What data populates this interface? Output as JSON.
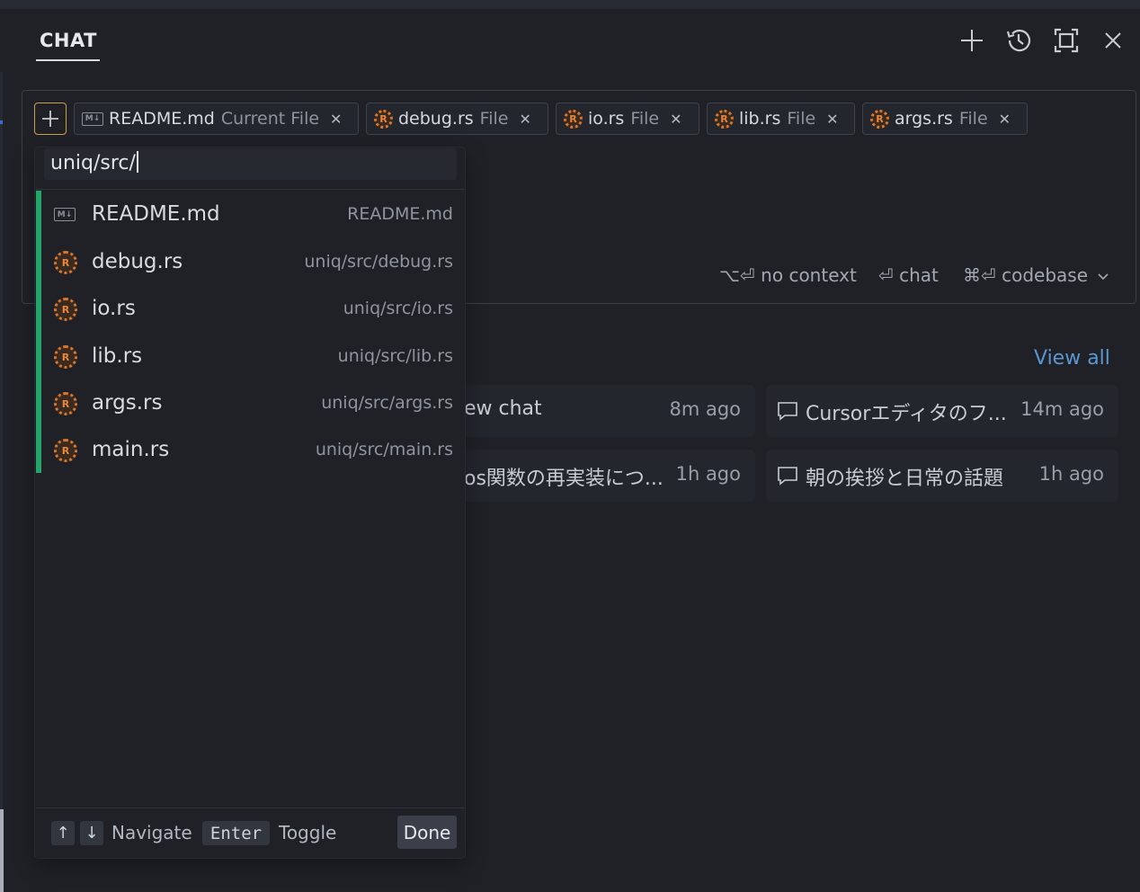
{
  "header": {
    "tab_label": "CHAT",
    "icons": [
      "plus-icon",
      "history-icon",
      "maximize-icon",
      "close-icon"
    ]
  },
  "context_pills": [
    {
      "name": "README.md",
      "type": "Current File",
      "icon": "markdown-icon"
    },
    {
      "name": "debug.rs",
      "type": "File",
      "icon": "rust-icon"
    },
    {
      "name": "io.rs",
      "type": "File",
      "icon": "rust-icon"
    },
    {
      "name": "lib.rs",
      "type": "File",
      "icon": "rust-icon"
    },
    {
      "name": "args.rs",
      "type": "File",
      "icon": "rust-icon"
    }
  ],
  "hints": {
    "no_context_key": "⌥⏎",
    "no_context": "no context",
    "chat_key": "⏎",
    "chat": "chat",
    "codebase_key": "⌘⏎",
    "codebase": "codebase"
  },
  "history": {
    "view_all": "View all",
    "items": [
      {
        "title": "ew chat",
        "time": "8m ago"
      },
      {
        "title": "Cursorエディタのフ...",
        "time": "14m ago"
      },
      {
        "title": "os関数の再実装につ...",
        "time": "1h ago"
      },
      {
        "title": "朝の挨拶と日常の話題",
        "time": "1h ago"
      }
    ]
  },
  "picker": {
    "query": "uniq/src/",
    "results": [
      {
        "name": "README.md",
        "path": "README.md",
        "icon": "markdown-icon"
      },
      {
        "name": "debug.rs",
        "path": "uniq/src/debug.rs",
        "icon": "rust-icon"
      },
      {
        "name": "io.rs",
        "path": "uniq/src/io.rs",
        "icon": "rust-icon"
      },
      {
        "name": "lib.rs",
        "path": "uniq/src/lib.rs",
        "icon": "rust-icon"
      },
      {
        "name": "args.rs",
        "path": "uniq/src/args.rs",
        "icon": "rust-icon"
      },
      {
        "name": "main.rs",
        "path": "uniq/src/main.rs",
        "icon": "rust-icon"
      }
    ],
    "footer": {
      "up_key": "↑",
      "down_key": "↓",
      "navigate": "Navigate",
      "enter_key": "Enter",
      "toggle": "Toggle",
      "done": "Done"
    }
  },
  "colors": {
    "background": "#1f2127",
    "accent_link": "#5b96cf",
    "selection_bar": "#24a56a",
    "add_button_border": "#c8a24a",
    "rust_icon": "#d9772f"
  }
}
